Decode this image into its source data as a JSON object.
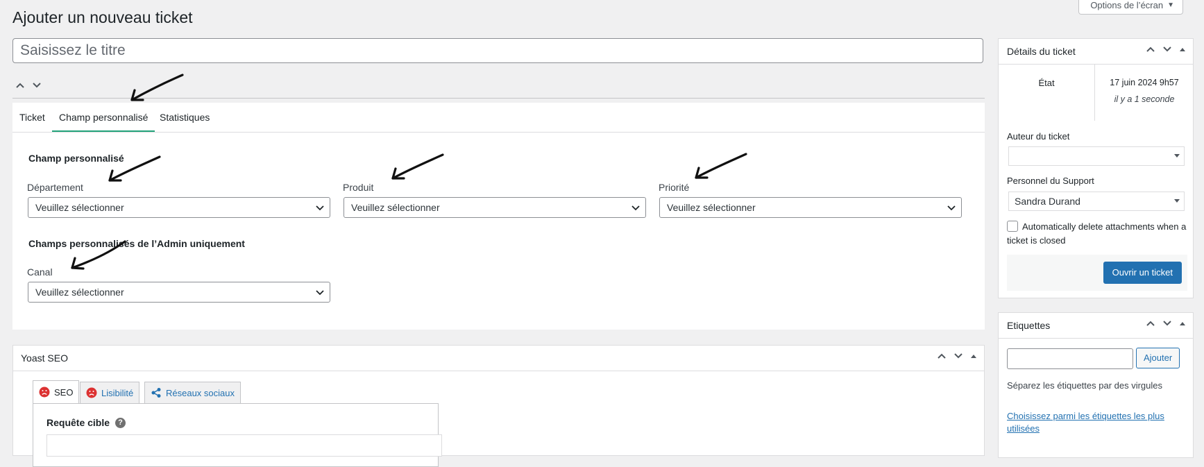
{
  "page": {
    "title": "Ajouter un nouveau ticket",
    "screen_options": "Options de l’écran"
  },
  "title_field": {
    "placeholder": "Saisissez le titre"
  },
  "tabs": [
    {
      "label": "Ticket"
    },
    {
      "label": "Champ personnalisé",
      "active": true
    },
    {
      "label": "Statistiques"
    }
  ],
  "custom_fields": {
    "section_title": "Champ personnalisé",
    "fields": [
      {
        "label": "Département",
        "value": "Veuillez sélectionner"
      },
      {
        "label": "Produit",
        "value": "Veuillez sélectionner"
      },
      {
        "label": "Priorité",
        "value": "Veuillez sélectionner"
      }
    ],
    "admin_section_title": "Champs personnalisés de l’Admin uniquement",
    "admin_fields": [
      {
        "label": "Canal",
        "value": "Veuillez sélectionner"
      }
    ]
  },
  "yoast": {
    "title": "Yoast SEO",
    "tabs": [
      {
        "label": "SEO",
        "icon": "sad-face-icon"
      },
      {
        "label": "Lisibilité",
        "icon": "sad-face-icon"
      },
      {
        "label": "Réseaux sociaux",
        "icon": "share-icon"
      }
    ],
    "focus_keyphrase_label": "Requête cible"
  },
  "details": {
    "title": "Détails du ticket",
    "state_label": "État",
    "date": "17 juin 2024 9h57",
    "relative": "il y a 1 seconde",
    "author_label": "Auteur du ticket",
    "author_value": "",
    "support_label": "Personnel du Support",
    "support_value": "Sandra Durand",
    "auto_delete_label": "Automatically delete attachments when a ticket is closed",
    "open_button": "Ouvrir un ticket"
  },
  "tags": {
    "title": "Etiquettes",
    "add_button": "Ajouter",
    "hint": "Séparez les étiquettes par des virgules",
    "choose_link": "Choisissez parmi les étiquettes les plus utilisées"
  },
  "colors": {
    "accent": "#2271b1",
    "tab_active": "#22a37a",
    "error_icon": "#dc3232"
  }
}
